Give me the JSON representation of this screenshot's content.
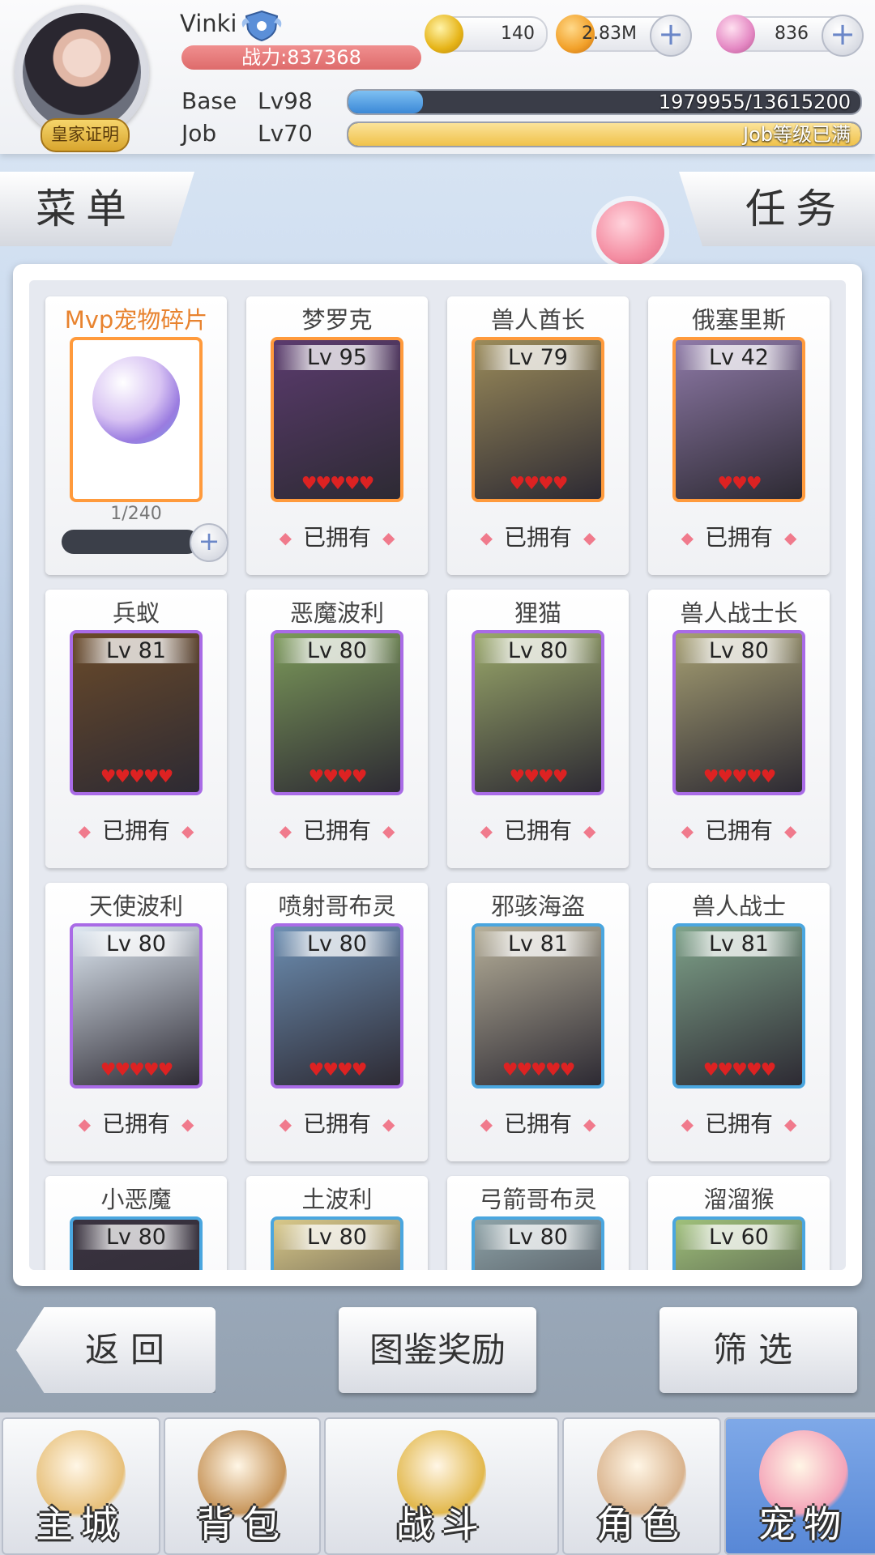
{
  "player": {
    "name": "Vinki",
    "badge": "皇家证明",
    "power_label": "战力:837368",
    "base_label": "Base",
    "base_level": "Lv98",
    "base_exp": "1979955/13615200",
    "base_exp_fraction": 0.145,
    "job_label": "Job",
    "job_level": "Lv70",
    "job_exp": "Job等级已满",
    "job_exp_fraction": 1.0
  },
  "currencies": [
    {
      "name": "zeny",
      "value": "140"
    },
    {
      "name": "gold",
      "value": "2.83M"
    },
    {
      "name": "gem",
      "value": "836"
    }
  ],
  "tabs": {
    "menu": "菜单",
    "quest": "任务"
  },
  "mvp": {
    "name": "Mvp宠物碎片",
    "progress": "1/240",
    "progress_fraction": 0.004
  },
  "pets": [
    {
      "name": "梦罗克",
      "level": "Lv 95",
      "stars": 5,
      "frame": "orange",
      "art": "#5b3b6e",
      "status": "已拥有"
    },
    {
      "name": "兽人酋长",
      "level": "Lv 79",
      "stars": 4,
      "frame": "orange",
      "art": "#9b8b5a",
      "status": "已拥有"
    },
    {
      "name": "俄塞里斯",
      "level": "Lv 42",
      "stars": 3,
      "frame": "orange",
      "art": "#8f7aa8",
      "status": "已拥有"
    },
    {
      "name": "兵蚁",
      "level": "Lv 81",
      "stars": 5,
      "frame": "purple",
      "art": "#6a4a2a",
      "status": "已拥有"
    },
    {
      "name": "恶魔波利",
      "level": "Lv 80",
      "stars": 4,
      "frame": "purple",
      "art": "#7c9a5a",
      "status": "已拥有"
    },
    {
      "name": "狸猫",
      "level": "Lv 80",
      "stars": 4,
      "frame": "purple",
      "art": "#9aa86a",
      "status": "已拥有"
    },
    {
      "name": "兽人战士长",
      "level": "Lv 80",
      "stars": 5,
      "frame": "purple",
      "art": "#a7a073",
      "status": "已拥有"
    },
    {
      "name": "天使波利",
      "level": "Lv 80",
      "stars": 5,
      "frame": "purple",
      "art": "#dfe9f3",
      "status": "已拥有"
    },
    {
      "name": "喷射哥布灵",
      "level": "Lv 80",
      "stars": 4,
      "frame": "purple",
      "art": "#6d8fb3",
      "status": "已拥有"
    },
    {
      "name": "邪骇海盗",
      "level": "Lv 81",
      "stars": 5,
      "frame": "blue",
      "art": "#b7b09a",
      "status": "已拥有"
    },
    {
      "name": "兽人战士",
      "level": "Lv 81",
      "stars": 5,
      "frame": "blue",
      "art": "#7fa38a",
      "status": "已拥有"
    },
    {
      "name": "小恶魔",
      "level": "Lv 80",
      "stars": 0,
      "frame": "blue",
      "art": "#3a3340",
      "status": ""
    },
    {
      "name": "土波利",
      "level": "Lv 80",
      "stars": 0,
      "frame": "blue",
      "art": "#d8c889",
      "status": ""
    },
    {
      "name": "弓箭哥布灵",
      "level": "Lv 80",
      "stars": 0,
      "frame": "blue",
      "art": "#8ea3a8",
      "status": ""
    },
    {
      "name": "溜溜猴",
      "level": "Lv 60",
      "stars": 0,
      "frame": "blue",
      "art": "#9fc07a",
      "status": ""
    }
  ],
  "actions": {
    "back": "返回",
    "rewards": "图鉴奖励",
    "filter": "筛选"
  },
  "nav": [
    {
      "label": "主城",
      "icon": "castle-icon",
      "active": false
    },
    {
      "label": "背包",
      "icon": "backpack-icon",
      "active": false
    },
    {
      "label": "战斗",
      "icon": "swords-icon",
      "active": false
    },
    {
      "label": "角色",
      "icon": "character-icon",
      "active": false
    },
    {
      "label": "宠物",
      "icon": "pet-icon",
      "active": true
    }
  ],
  "colors": {
    "accent": "#e8832f",
    "frame_orange": "#ff9a3c",
    "frame_purple": "#a96be6",
    "frame_blue": "#4aa6df",
    "active_nav": "#5787d6"
  }
}
